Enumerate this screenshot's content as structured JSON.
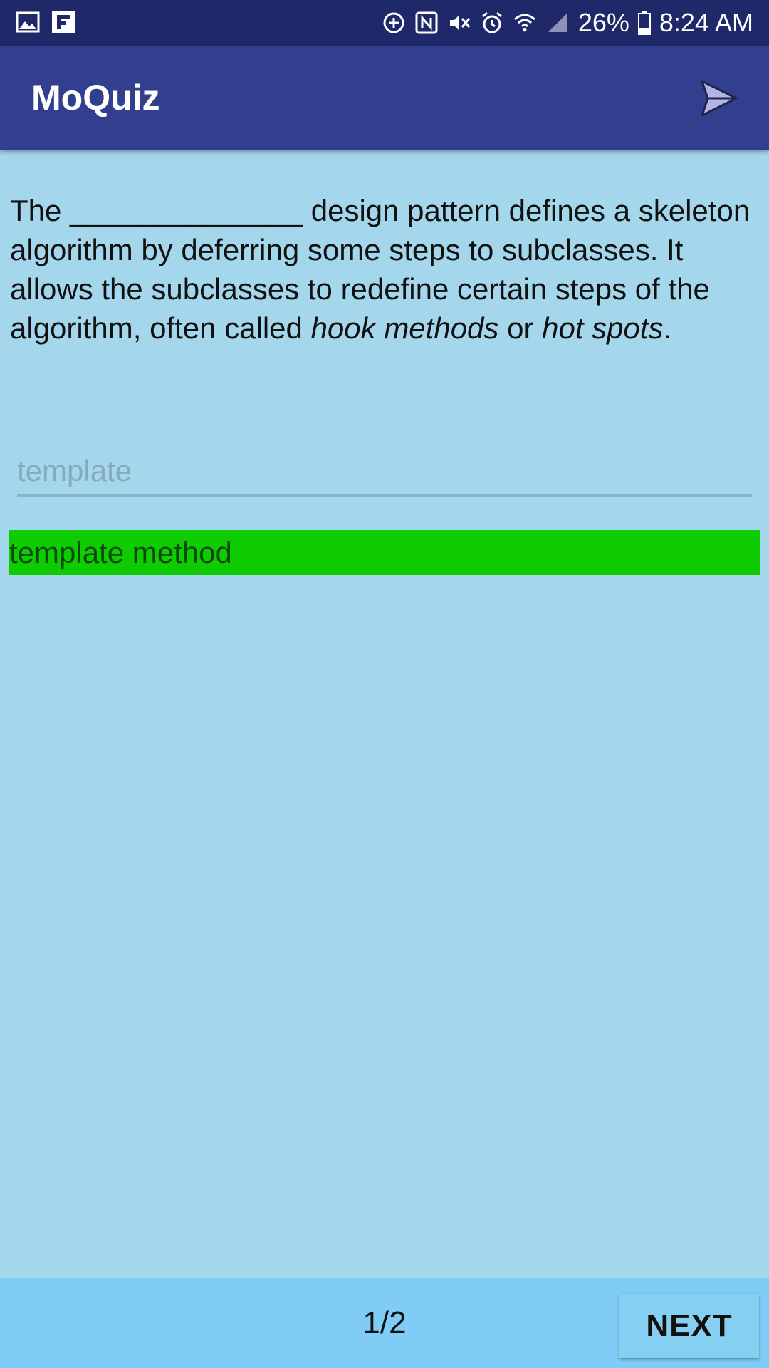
{
  "status_bar": {
    "battery": "26%",
    "time": "8:24 AM",
    "left_icons": [
      "gallery-icon",
      "flipboard-icon"
    ],
    "right_icons": [
      "data-saver-icon",
      "nfc-icon",
      "mute-icon",
      "alarm-icon",
      "wifi-icon",
      "signal-icon",
      "battery-icon"
    ]
  },
  "app_bar": {
    "title": "MoQuiz",
    "action_icon": "send-icon"
  },
  "question": {
    "part1": "The ",
    "blank": "______________",
    "part2": " design pattern defines a skeleton algorithm by deferring some steps to subclasses. It allows the subclasses to redefine certain steps of the algorithm, often called ",
    "italic1": "hook methods",
    "part3": " or ",
    "italic2": "hot spots",
    "part4": "."
  },
  "answer_input": {
    "placeholder": "template",
    "value": ""
  },
  "correct_answer": {
    "text": "template method",
    "color": "#0fcc00"
  },
  "footer": {
    "page_indicator": "1/2",
    "next_label": "NEXT"
  },
  "colors": {
    "status_bar": "#1f2868",
    "app_bar": "#323f8f",
    "background": "#a4d6ec",
    "bottom_bar": "#7fcdf5"
  }
}
